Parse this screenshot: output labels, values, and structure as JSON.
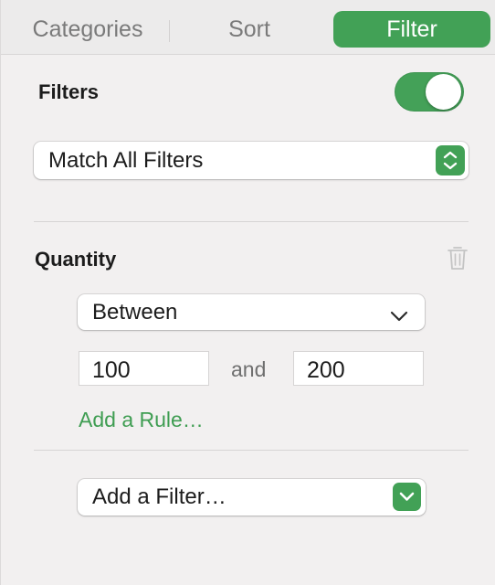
{
  "tabs": {
    "categories": "Categories",
    "sort": "Sort",
    "filter": "Filter",
    "active": "Filter"
  },
  "filters": {
    "title": "Filters",
    "enabled": true,
    "match_mode": "Match All Filters"
  },
  "rule": {
    "field": "Quantity",
    "operator": "Between",
    "min_value": "100",
    "joiner": "and",
    "max_value": "200",
    "add_rule_label": "Add a Rule…"
  },
  "add_filter": {
    "label": "Add a Filter…"
  },
  "colors": {
    "accent": "#42a156",
    "link": "#3f9d52",
    "background": "#f2f0f0"
  },
  "icons": {
    "match_stepper": "up-down-chevron-icon",
    "trash": "trash-icon",
    "operator_dropdown": "chevron-down-icon",
    "add_filter_dropdown": "chevron-down-icon"
  }
}
